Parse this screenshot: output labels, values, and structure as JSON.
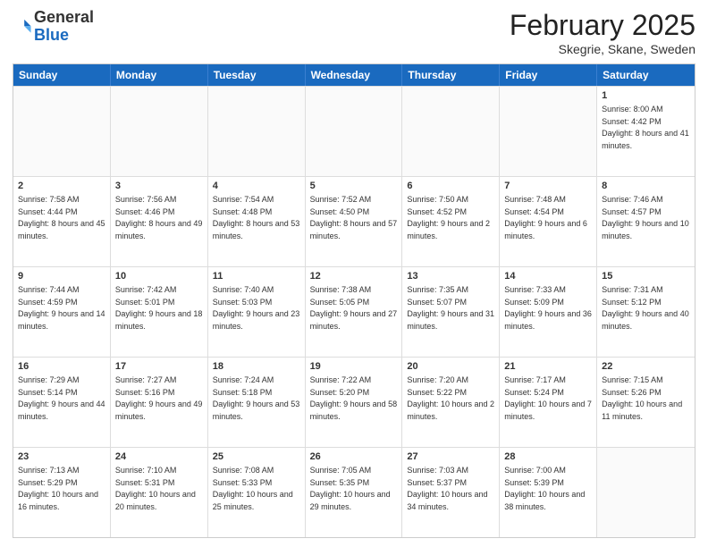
{
  "header": {
    "logo": {
      "general": "General",
      "blue": "Blue"
    },
    "title": "February 2025",
    "subtitle": "Skegrie, Skane, Sweden"
  },
  "weekdays": [
    "Sunday",
    "Monday",
    "Tuesday",
    "Wednesday",
    "Thursday",
    "Friday",
    "Saturday"
  ],
  "weeks": [
    [
      {
        "day": "",
        "empty": true
      },
      {
        "day": "",
        "empty": true
      },
      {
        "day": "",
        "empty": true
      },
      {
        "day": "",
        "empty": true
      },
      {
        "day": "",
        "empty": true
      },
      {
        "day": "",
        "empty": true
      },
      {
        "day": "1",
        "sunrise": "Sunrise: 8:00 AM",
        "sunset": "Sunset: 4:42 PM",
        "daylight": "Daylight: 8 hours and 41 minutes."
      }
    ],
    [
      {
        "day": "2",
        "sunrise": "Sunrise: 7:58 AM",
        "sunset": "Sunset: 4:44 PM",
        "daylight": "Daylight: 8 hours and 45 minutes."
      },
      {
        "day": "3",
        "sunrise": "Sunrise: 7:56 AM",
        "sunset": "Sunset: 4:46 PM",
        "daylight": "Daylight: 8 hours and 49 minutes."
      },
      {
        "day": "4",
        "sunrise": "Sunrise: 7:54 AM",
        "sunset": "Sunset: 4:48 PM",
        "daylight": "Daylight: 8 hours and 53 minutes."
      },
      {
        "day": "5",
        "sunrise": "Sunrise: 7:52 AM",
        "sunset": "Sunset: 4:50 PM",
        "daylight": "Daylight: 8 hours and 57 minutes."
      },
      {
        "day": "6",
        "sunrise": "Sunrise: 7:50 AM",
        "sunset": "Sunset: 4:52 PM",
        "daylight": "Daylight: 9 hours and 2 minutes."
      },
      {
        "day": "7",
        "sunrise": "Sunrise: 7:48 AM",
        "sunset": "Sunset: 4:54 PM",
        "daylight": "Daylight: 9 hours and 6 minutes."
      },
      {
        "day": "8",
        "sunrise": "Sunrise: 7:46 AM",
        "sunset": "Sunset: 4:57 PM",
        "daylight": "Daylight: 9 hours and 10 minutes."
      }
    ],
    [
      {
        "day": "9",
        "sunrise": "Sunrise: 7:44 AM",
        "sunset": "Sunset: 4:59 PM",
        "daylight": "Daylight: 9 hours and 14 minutes."
      },
      {
        "day": "10",
        "sunrise": "Sunrise: 7:42 AM",
        "sunset": "Sunset: 5:01 PM",
        "daylight": "Daylight: 9 hours and 18 minutes."
      },
      {
        "day": "11",
        "sunrise": "Sunrise: 7:40 AM",
        "sunset": "Sunset: 5:03 PM",
        "daylight": "Daylight: 9 hours and 23 minutes."
      },
      {
        "day": "12",
        "sunrise": "Sunrise: 7:38 AM",
        "sunset": "Sunset: 5:05 PM",
        "daylight": "Daylight: 9 hours and 27 minutes."
      },
      {
        "day": "13",
        "sunrise": "Sunrise: 7:35 AM",
        "sunset": "Sunset: 5:07 PM",
        "daylight": "Daylight: 9 hours and 31 minutes."
      },
      {
        "day": "14",
        "sunrise": "Sunrise: 7:33 AM",
        "sunset": "Sunset: 5:09 PM",
        "daylight": "Daylight: 9 hours and 36 minutes."
      },
      {
        "day": "15",
        "sunrise": "Sunrise: 7:31 AM",
        "sunset": "Sunset: 5:12 PM",
        "daylight": "Daylight: 9 hours and 40 minutes."
      }
    ],
    [
      {
        "day": "16",
        "sunrise": "Sunrise: 7:29 AM",
        "sunset": "Sunset: 5:14 PM",
        "daylight": "Daylight: 9 hours and 44 minutes."
      },
      {
        "day": "17",
        "sunrise": "Sunrise: 7:27 AM",
        "sunset": "Sunset: 5:16 PM",
        "daylight": "Daylight: 9 hours and 49 minutes."
      },
      {
        "day": "18",
        "sunrise": "Sunrise: 7:24 AM",
        "sunset": "Sunset: 5:18 PM",
        "daylight": "Daylight: 9 hours and 53 minutes."
      },
      {
        "day": "19",
        "sunrise": "Sunrise: 7:22 AM",
        "sunset": "Sunset: 5:20 PM",
        "daylight": "Daylight: 9 hours and 58 minutes."
      },
      {
        "day": "20",
        "sunrise": "Sunrise: 7:20 AM",
        "sunset": "Sunset: 5:22 PM",
        "daylight": "Daylight: 10 hours and 2 minutes."
      },
      {
        "day": "21",
        "sunrise": "Sunrise: 7:17 AM",
        "sunset": "Sunset: 5:24 PM",
        "daylight": "Daylight: 10 hours and 7 minutes."
      },
      {
        "day": "22",
        "sunrise": "Sunrise: 7:15 AM",
        "sunset": "Sunset: 5:26 PM",
        "daylight": "Daylight: 10 hours and 11 minutes."
      }
    ],
    [
      {
        "day": "23",
        "sunrise": "Sunrise: 7:13 AM",
        "sunset": "Sunset: 5:29 PM",
        "daylight": "Daylight: 10 hours and 16 minutes."
      },
      {
        "day": "24",
        "sunrise": "Sunrise: 7:10 AM",
        "sunset": "Sunset: 5:31 PM",
        "daylight": "Daylight: 10 hours and 20 minutes."
      },
      {
        "day": "25",
        "sunrise": "Sunrise: 7:08 AM",
        "sunset": "Sunset: 5:33 PM",
        "daylight": "Daylight: 10 hours and 25 minutes."
      },
      {
        "day": "26",
        "sunrise": "Sunrise: 7:05 AM",
        "sunset": "Sunset: 5:35 PM",
        "daylight": "Daylight: 10 hours and 29 minutes."
      },
      {
        "day": "27",
        "sunrise": "Sunrise: 7:03 AM",
        "sunset": "Sunset: 5:37 PM",
        "daylight": "Daylight: 10 hours and 34 minutes."
      },
      {
        "day": "28",
        "sunrise": "Sunrise: 7:00 AM",
        "sunset": "Sunset: 5:39 PM",
        "daylight": "Daylight: 10 hours and 38 minutes."
      },
      {
        "day": "",
        "empty": true
      }
    ]
  ]
}
